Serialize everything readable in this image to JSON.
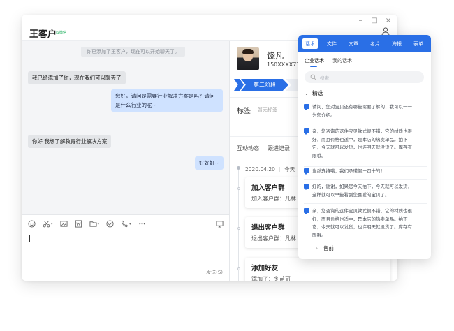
{
  "window": {
    "controls": [
      "–",
      "□",
      "×"
    ],
    "contact_name": "王客户",
    "contact_tag": "@微信"
  },
  "chat": {
    "system_message": "你已添加了王客户，现在可以开始聊天了。",
    "messages": [
      {
        "side": "left",
        "text": "我已经添加了你，现在我们可以聊天了"
      },
      {
        "side": "right",
        "line1": "您好，请问是需要行业解决方案是吗？请问",
        "line2": "是什么行业的呢~"
      },
      {
        "side": "left",
        "text": "你好 我想了解教育行业解决方案"
      },
      {
        "side": "right",
        "text": "好好好~"
      }
    ],
    "send_label": "发送(S)"
  },
  "toolbar_icons": [
    "emoji-icon",
    "scissors-icon",
    "image-icon",
    "word-file-icon",
    "folder-icon",
    "check-circle-icon",
    "phone-icon",
    "more-icon",
    "screen-capture-icon"
  ],
  "profile": {
    "name": "饶凡",
    "phone": "150XXXX77",
    "stage": "第二阶段",
    "tags_label": "标签",
    "tags_empty": "暂无标签",
    "tabs": [
      "互动动态",
      "跟进记录"
    ],
    "timeline_date": "2020.04.20",
    "timeline_day": "今天",
    "events": [
      {
        "title": "加入客户群",
        "detail": "加入客户群：凡林"
      },
      {
        "title": "退出客户群",
        "detail": "退出客户群：凡林"
      },
      {
        "title": "添加好友",
        "detail": "添加了：冬苗哥"
      }
    ]
  },
  "scripts": {
    "tabs": [
      "话术",
      "文件",
      "文章",
      "名片",
      "海报",
      "表单"
    ],
    "sub_tabs": [
      "企业话术",
      "我的话术"
    ],
    "search_placeholder": "搜索",
    "section": "精选",
    "replies": [
      [
        "请问，您对宝贝还有哪些需要了解的，我可以一一",
        "为您介绍。"
      ],
      [
        "亲，您咨询的这件宝贝款式很不错，它的材质也很",
        "好，而且价格也适中，是本店的热卖单品。拍下",
        "它，今天就可以发货，也许明天就没货了。库存有",
        "限哦。"
      ],
      [
        "当然支持哦，我们承诺假一罚十的！"
      ],
      [
        "好的，谢谢，如果您今天拍下，今天就可以发货，",
        "这样就可以早些看到您喜爱的宝贝了。"
      ],
      [
        "亲，您咨询的这件宝贝款式很不错，它的材质也很",
        "好，而且价格也适中，是本店的热卖单品。拍下",
        "它，今天就可以发货，也许明天就没货了。库存有",
        "限哦。"
      ]
    ],
    "footer_group": "售前"
  },
  "colors": {
    "accent": "#2a6fe6",
    "bubble_right": "#cfe2ff",
    "bubble_left": "#e3e5e8",
    "tag_green": "#1aad5a"
  }
}
